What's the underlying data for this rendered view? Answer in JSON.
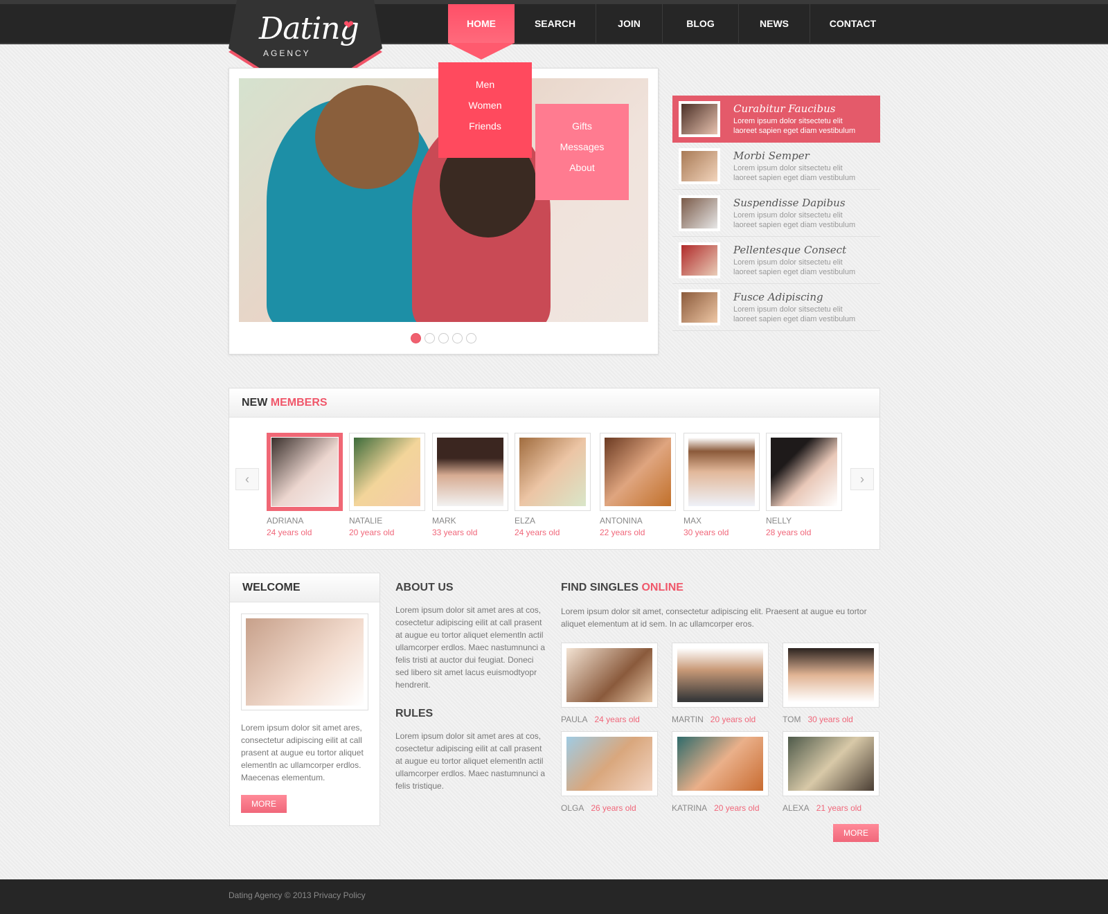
{
  "brand": {
    "name": "Dating",
    "sub": "AGENCY",
    "accent": "#ff4f67"
  },
  "nav": {
    "items": [
      {
        "label": "HOME",
        "active": true
      },
      {
        "label": "SEARCH"
      },
      {
        "label": "JOIN"
      },
      {
        "label": "BLOG"
      },
      {
        "label": "NEWS"
      },
      {
        "label": "CONTACT"
      }
    ],
    "dropdown": [
      "Men",
      "Women",
      "Friends"
    ],
    "subdropdown": [
      "Gifts",
      "Messages",
      "About"
    ]
  },
  "slider": {
    "slides": 5,
    "active_slide": 1
  },
  "side_list": [
    {
      "title": "Curabitur Faucibus",
      "line1": "Lorem ipsum dolor sitsectetu elit",
      "line2": "laoreet sapien eget diam vestibulum",
      "active": true
    },
    {
      "title": "Morbi Semper",
      "line1": "Lorem ipsum   dolor sitsectetu elit",
      "line2": "laoreet sapien eget diam vestibulum"
    },
    {
      "title": "Suspendisse Dapibus",
      "line1": "Lorem ipsum dolor sitsectetu elit",
      "line2": "laoreet sapien eget diam vestibulum"
    },
    {
      "title": "Pellentesque Consect",
      "line1": "Lorem ipsum dolor sitsectetu elit",
      "line2": "laoreet sapien eget diam vestibulum"
    },
    {
      "title": "Fusce Adipiscing",
      "line1": "Lorem ipsum dolor sitsectetu elit",
      "line2": "laoreet sapien eget diam vestibulum"
    }
  ],
  "new_members": {
    "title_a": "NEW",
    "title_b": "MEMBERS",
    "prev_icon": "‹",
    "next_icon": "›",
    "members": [
      {
        "name": "ADRIANA",
        "age": "24 years old"
      },
      {
        "name": "NATALIE",
        "age": "20 years old"
      },
      {
        "name": "MARK",
        "age": "33 years old"
      },
      {
        "name": "ELZA",
        "age": "24 years old"
      },
      {
        "name": "ANTONINA",
        "age": "22 years old"
      },
      {
        "name": "MAX",
        "age": "30 years old"
      },
      {
        "name": "NELLY",
        "age": "28 years old"
      }
    ]
  },
  "welcome": {
    "title": "WELCOME",
    "text": "Lorem ipsum dolor sit amet ares, consectetur adipiscing eilit at call prasent at augue eu tortor aliquet elementln ac ullamcorper erdlos. Maecenas elementum.",
    "more": "MORE"
  },
  "about": {
    "title": "ABOUT US",
    "text": "Lorem ipsum dolor sit amet ares at cos, cosectetur adipiscing eilit at call prasent at augue eu tortor aliquet elementln actil ullamcorper erdlos.  Maec nastumnunci a felis tristi at auctor dui feugiat. Doneci sed libero sit amet lacus euismodtyopr hendrerit."
  },
  "rules": {
    "title": "RULES",
    "text": "Lorem ipsum dolor sit amet ares at cos, cosectetur adipiscing eilit at call prasent at augue eu tortor aliquet elementln actil ullamcorper erdlos.  Maec nastumnunci a felis tristique."
  },
  "find_singles": {
    "title_a": "FIND SINGLES",
    "title_b": "ONLINE",
    "text": "Lorem ipsum dolor sit amet, consectetur adipiscing elit. Praesent at augue eu tortor aliquet elementum at id sem. In ac ullamcorper eros.",
    "more": "MORE",
    "singles": [
      {
        "name": "PAULA",
        "age": "24 years old"
      },
      {
        "name": "MARTIN",
        "age": "20 years old"
      },
      {
        "name": "TOM",
        "age": "30 years old"
      },
      {
        "name": "OLGA",
        "age": "26 years old"
      },
      {
        "name": "KATRINA",
        "age": "20 years old"
      },
      {
        "name": "ALEXA",
        "age": "21 years old"
      }
    ]
  },
  "footer": {
    "text": "Dating Agency © 2013 Privacy Policy"
  }
}
